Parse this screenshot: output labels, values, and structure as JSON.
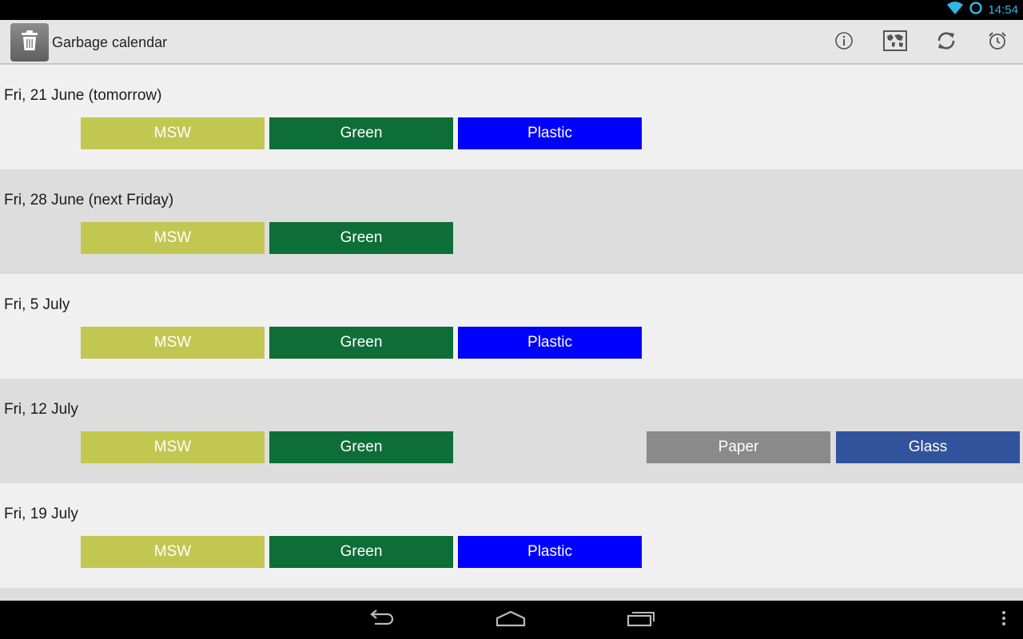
{
  "status_bar": {
    "time": "14:54",
    "icons": [
      "wifi-icon",
      "sync-icon"
    ],
    "accent": "#33b5e5"
  },
  "app": {
    "title": "Garbage calendar",
    "icon": "trash-can-icon",
    "actions": [
      {
        "name": "info-button",
        "icon": "info-icon"
      },
      {
        "name": "map-button",
        "icon": "map-icon"
      },
      {
        "name": "refresh-button",
        "icon": "refresh-icon"
      },
      {
        "name": "alarm-button",
        "icon": "alarm-clock-icon"
      }
    ]
  },
  "colors": {
    "MSW": "#c1c750",
    "Green": "#0e6e37",
    "Plastic": "#0000ff",
    "Paper": "#8a8a8a",
    "Glass": "#31539b"
  },
  "days": [
    {
      "date": "Fri, 21 June (tomorrow)",
      "chips": [
        {
          "label": "MSW",
          "slot": 0
        },
        {
          "label": "Green",
          "slot": 1
        },
        {
          "label": "Plastic",
          "slot": 2
        }
      ]
    },
    {
      "date": "Fri, 28 June (next Friday)",
      "chips": [
        {
          "label": "MSW",
          "slot": 0
        },
        {
          "label": "Green",
          "slot": 1
        }
      ]
    },
    {
      "date": "Fri, 5 July",
      "chips": [
        {
          "label": "MSW",
          "slot": 0
        },
        {
          "label": "Green",
          "slot": 1
        },
        {
          "label": "Plastic",
          "slot": 2
        }
      ]
    },
    {
      "date": "Fri, 12 July",
      "chips": [
        {
          "label": "MSW",
          "slot": 0
        },
        {
          "label": "Green",
          "slot": 1
        },
        {
          "label": "Paper",
          "slot": 4
        },
        {
          "label": "Glass",
          "slot": 5
        }
      ]
    },
    {
      "date": "Fri, 19 July",
      "chips": [
        {
          "label": "MSW",
          "slot": 0
        },
        {
          "label": "Green",
          "slot": 1
        },
        {
          "label": "Plastic",
          "slot": 2
        }
      ]
    }
  ],
  "nav_bar": [
    "back-icon",
    "home-icon",
    "recent-apps-icon",
    "overflow-menu-icon"
  ]
}
